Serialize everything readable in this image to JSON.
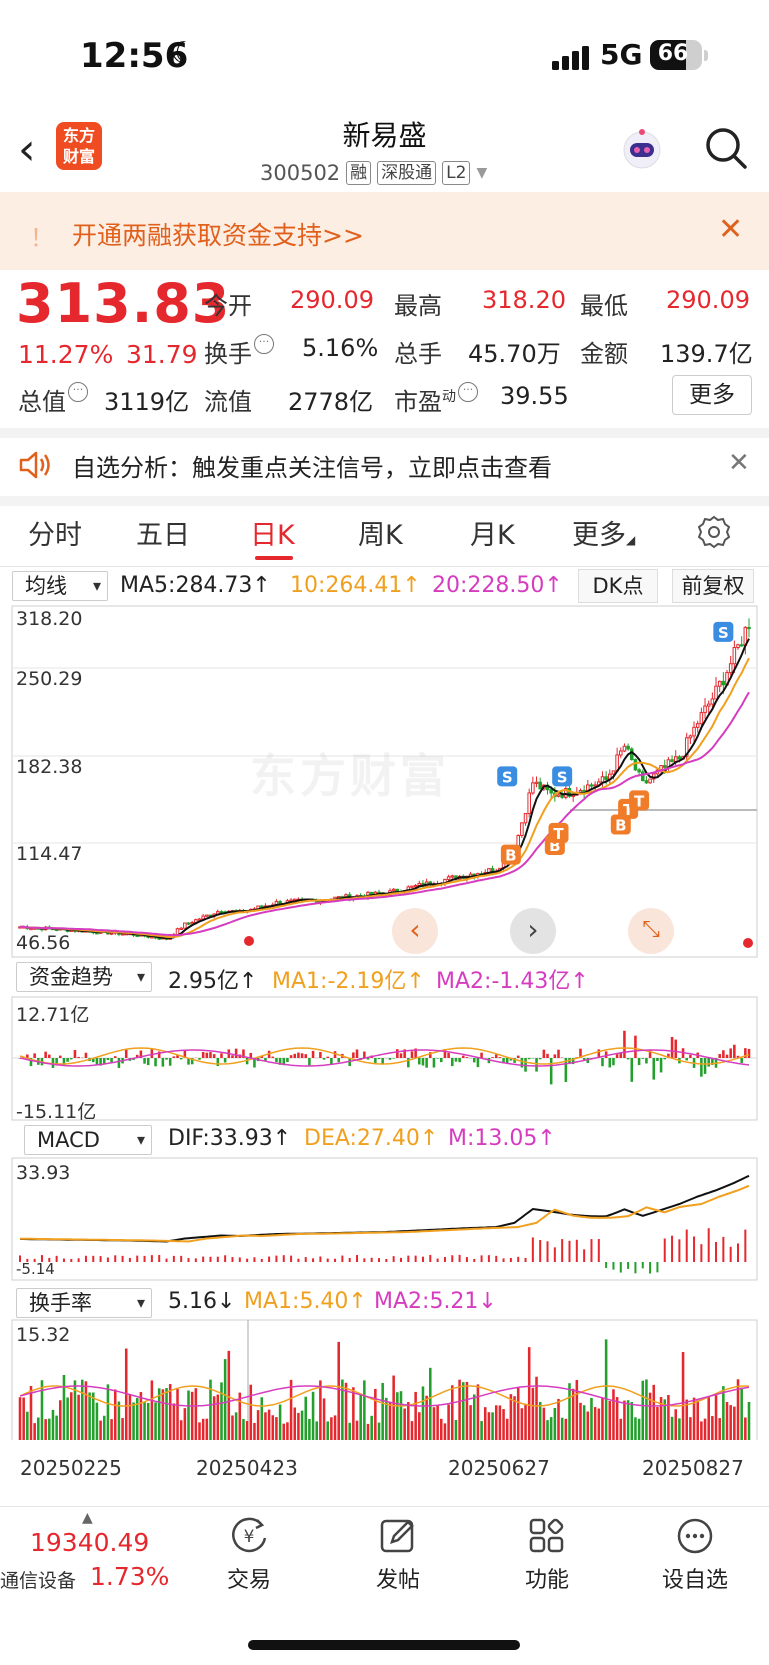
{
  "status": {
    "time": "12:56",
    "network": "5G",
    "battery": "66"
  },
  "header": {
    "logo": [
      "东方",
      "财富"
    ],
    "name": "新易盛",
    "code": "300502",
    "tags": [
      "融",
      "深股通",
      "L2"
    ]
  },
  "banner": {
    "text": "开通两融获取资金支持>>"
  },
  "quote": {
    "price": "313.83",
    "change_pct": "11.27%",
    "change": "31.79",
    "fields": [
      {
        "label": "今开",
        "value": "290.09",
        "red": true
      },
      {
        "label": "最高",
        "value": "318.20",
        "red": true
      },
      {
        "label": "最低",
        "value": "290.09",
        "red": true
      },
      {
        "label": "换手",
        "value": "5.16%"
      },
      {
        "label": "总手",
        "value": "45.70万"
      },
      {
        "label": "金额",
        "value": "139.7亿"
      },
      {
        "label": "总值",
        "value": "3119亿"
      },
      {
        "label": "流值",
        "value": "2778亿"
      },
      {
        "label": "市盈",
        "sup": "动",
        "value": "39.55"
      }
    ],
    "more_label": "更多"
  },
  "analysis": {
    "text": "自选分析：触发重点关注信号，立即点击查看"
  },
  "tabs": [
    "分时",
    "五日",
    "日K",
    "周K",
    "月K",
    "更多"
  ],
  "active_tab": "日K",
  "ma_row": {
    "selector": "均线",
    "ma5": "MA5:284.73↑",
    "ma10": "10:264.41↑",
    "ma20": "20:228.50↑",
    "dk": "DK点",
    "fq": "前复权"
  },
  "fund_row": {
    "selector": "资金趋势",
    "value": "2.95亿↑",
    "ma1": "MA1:-2.19亿↑",
    "ma2": "MA2:-1.43亿↑"
  },
  "macd_row": {
    "selector": "MACD",
    "dif": "DIF:33.93↑",
    "dea": "DEA:27.40↑",
    "m": "M:13.05↑"
  },
  "turn_row": {
    "selector": "换手率",
    "value": "5.16↓",
    "ma1": "MA1:5.40↑",
    "ma2": "MA2:5.21↓"
  },
  "chart_data": {
    "type": "candlestick",
    "watermark": "东方财富",
    "price_axis": [
      "318.20",
      "250.29",
      "182.38",
      "114.47",
      "46.56"
    ],
    "ylim": [
      46.56,
      318.2
    ],
    "fund_axis": [
      "12.71亿",
      "-15.11亿"
    ],
    "macd_axis": [
      "33.93",
      "-5.14"
    ],
    "turn_axis": [
      "15.32"
    ],
    "dates": [
      "20250225",
      "20250423",
      "20250627",
      "20250827"
    ],
    "series": [
      {
        "name": "MA5",
        "color": "#111111"
      },
      {
        "name": "MA10",
        "color": "#f0a01e"
      },
      {
        "name": "MA20",
        "color": "#d63cbf"
      }
    ],
    "close_path": [
      [
        0,
        60
      ],
      [
        10,
        58
      ],
      [
        20,
        56
      ],
      [
        30,
        54
      ],
      [
        40,
        50
      ],
      [
        45,
        62
      ],
      [
        55,
        74
      ],
      [
        60,
        72
      ],
      [
        70,
        80
      ],
      [
        80,
        82
      ],
      [
        90,
        85
      ],
      [
        100,
        88
      ],
      [
        110,
        95
      ],
      [
        120,
        102
      ],
      [
        130,
        108
      ],
      [
        135,
        125
      ],
      [
        140,
        180
      ],
      [
        145,
        170
      ],
      [
        150,
        172
      ],
      [
        160,
        182
      ],
      [
        165,
        210
      ],
      [
        170,
        178
      ],
      [
        175,
        190
      ],
      [
        180,
        200
      ],
      [
        185,
        230
      ],
      [
        190,
        255
      ],
      [
        195,
        285
      ],
      [
        199,
        313
      ]
    ],
    "signals": [
      {
        "t": "B",
        "x": 134,
        "y": 120
      },
      {
        "t": "S",
        "x": 133,
        "y": 185
      },
      {
        "t": "B",
        "x": 146,
        "y": 128
      },
      {
        "t": "T",
        "x": 147,
        "y": 138
      },
      {
        "t": "S",
        "x": 148,
        "y": 185
      },
      {
        "t": "B",
        "x": 164,
        "y": 145
      },
      {
        "t": "T",
        "x": 166,
        "y": 158
      },
      {
        "t": "T",
        "x": 169,
        "y": 165
      },
      {
        "t": "S",
        "x": 192,
        "y": 305
      }
    ]
  },
  "bottom": {
    "index_value": "19340.49",
    "index_name": "通信设备",
    "index_pct": "1.73%",
    "nav": [
      "交易",
      "发帖",
      "功能",
      "设自选"
    ]
  }
}
